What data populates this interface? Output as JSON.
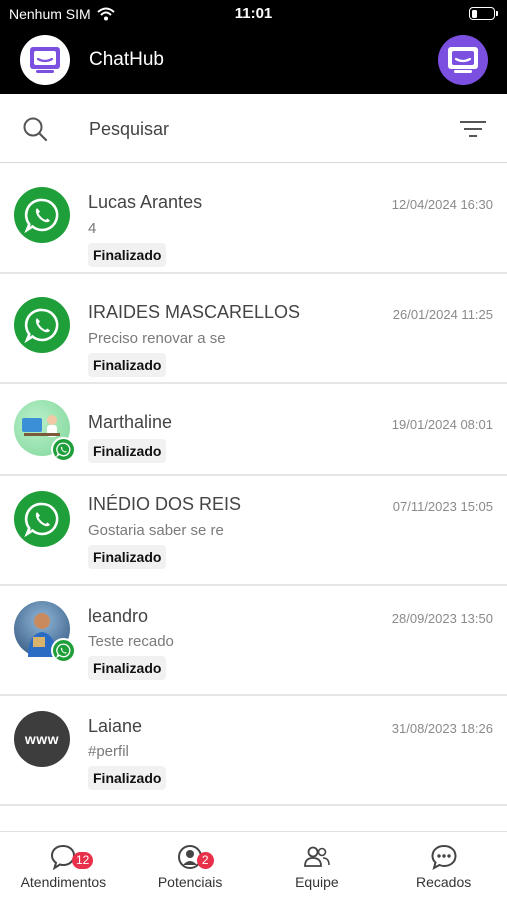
{
  "status_bar": {
    "carrier": "Nenhum SIM",
    "time": "11:01",
    "battery_level": 0.25
  },
  "header": {
    "title": "ChatHub"
  },
  "search": {
    "placeholder": "Pesquisar"
  },
  "conversations": [
    {
      "name": "Lucas Arantes",
      "date": "12/04/2024 16:30",
      "message": "4",
      "status": "Finalizado",
      "avatar": "whatsapp-icon"
    },
    {
      "name": "IRAIDES MASCARELLOS",
      "date": "26/01/2024 11:25",
      "message": "Preciso renovar a se",
      "status": "Finalizado",
      "avatar": "whatsapp-icon"
    },
    {
      "name": "Marthaline",
      "date": "19/01/2024 08:01",
      "message": "",
      "status": "Finalizado",
      "avatar": "photo"
    },
    {
      "name": "INÉDIO DOS REIS",
      "date": "07/11/2023 15:05",
      "message": "Gostaria saber se re",
      "status": "Finalizado",
      "avatar": "whatsapp-icon"
    },
    {
      "name": "leandro",
      "date": "28/09/2023 13:50",
      "message": "Teste recado",
      "status": "Finalizado",
      "avatar": "photo"
    },
    {
      "name": "Laiane",
      "date": "31/08/2023 18:26",
      "message": "#perfil",
      "status": "Finalizado",
      "avatar": "www"
    }
  ],
  "bottom_nav": [
    {
      "label": "Atendimentos",
      "badge": "12",
      "icon": "chat-bubble-icon"
    },
    {
      "label": "Potenciais",
      "badge": "2",
      "icon": "user-circle-icon"
    },
    {
      "label": "Equipe",
      "badge": "",
      "icon": "team-icon"
    },
    {
      "label": "Recados",
      "badge": "",
      "icon": "message-dots-icon"
    }
  ],
  "colors": {
    "header_bg": "#000000",
    "whatsapp_green": "#1f9f3a",
    "badge_red": "#e8304a",
    "brand_purple": "#7b4fe0"
  },
  "avatar_text": {
    "www": "www"
  }
}
